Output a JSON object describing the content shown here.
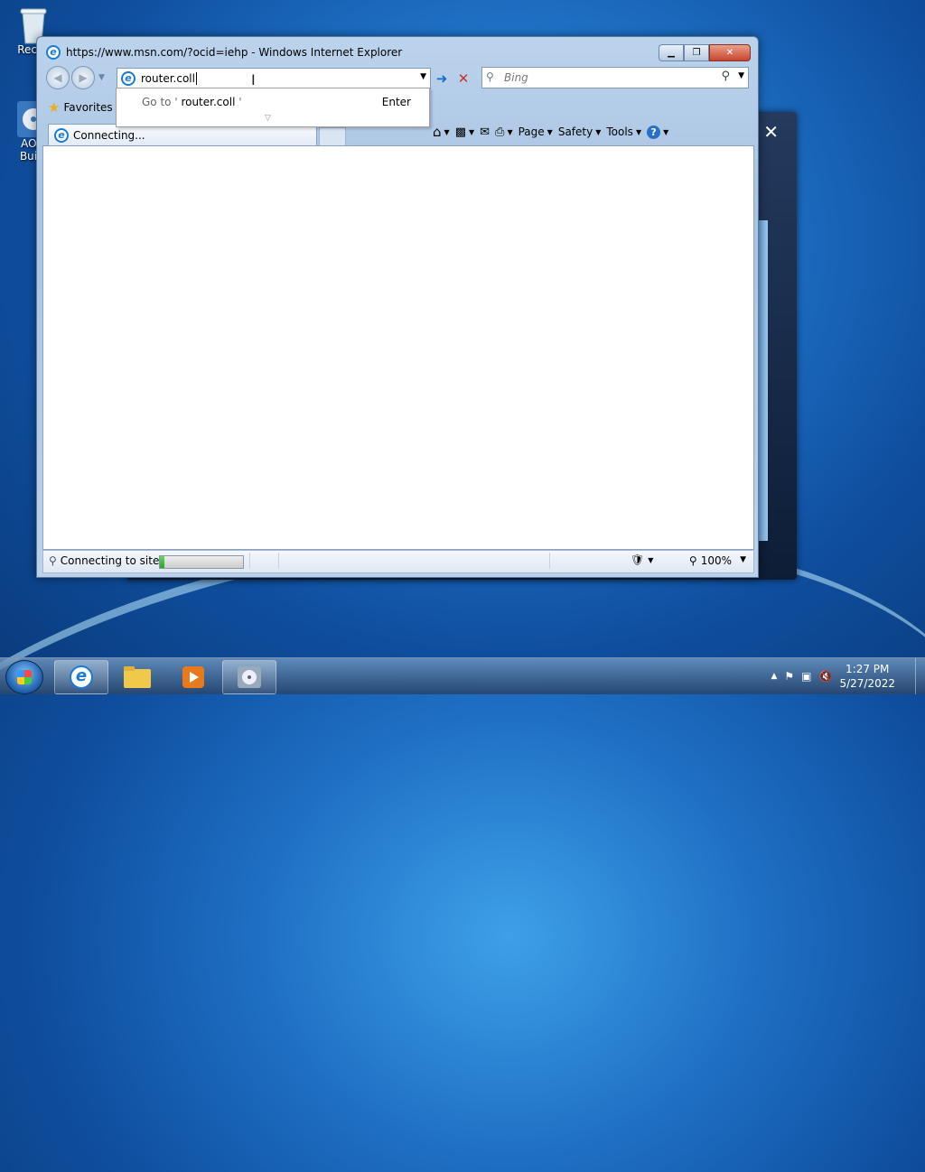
{
  "desktop": {
    "icons": [
      {
        "label": "Recyc"
      },
      {
        "label_line1": "AOM",
        "label_line2": "Build"
      }
    ]
  },
  "ie": {
    "title": "https://www.msn.com/?ocid=iehp - Windows Internet Explorer",
    "address_value": "router.coll",
    "search_placeholder": "Bing",
    "suggest": {
      "goto_prefix": "Go to ' ",
      "goto_value": "router.coll",
      "goto_suffix": " '",
      "enter": "Enter"
    },
    "favorites_label": "Favorites",
    "tab_label": "Connecting...",
    "command_bar": {
      "page": "Page",
      "safety": "Safety",
      "tools": "Tools"
    },
    "status": {
      "text": "Connecting to site",
      "progress": 0.05,
      "zoom": "100%"
    }
  },
  "taskbar": {
    "time": "1:27 PM",
    "date": "5/27/2022"
  }
}
